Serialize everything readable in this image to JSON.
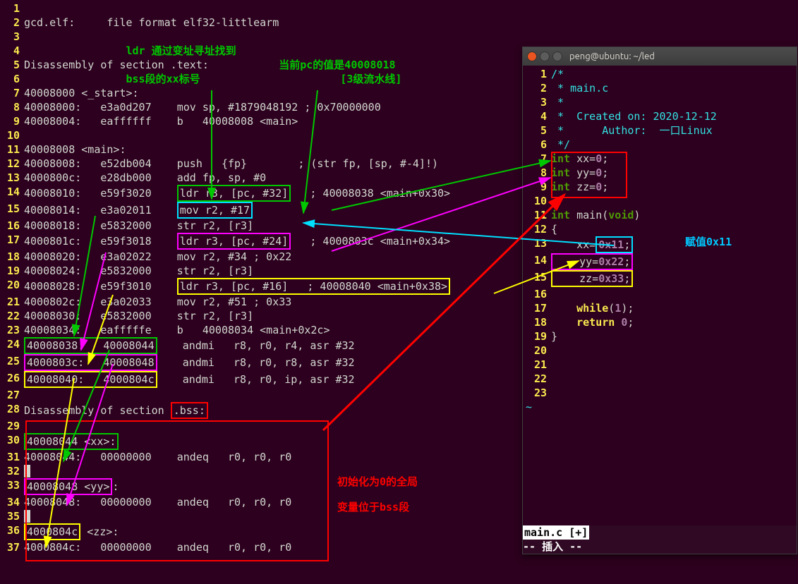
{
  "annotations": {
    "green1": "ldr 通过变址寻址找到",
    "green2": "bss段的xx标号",
    "green3": "当前pc的值是40008018",
    "green4": "[3级流水线]",
    "red1a": "初始化为0的全局",
    "red1b": "变量位于bss段",
    "cyan1": "赋值0x11"
  },
  "left_code": [
    "",
    "gcd.elf:     file format elf32-littlearm",
    "",
    "",
    "Disassembly of section .text:",
    "",
    "40008000 <_start>:",
    "40008000:   e3a0d207    mov sp, #1879048192 ; 0x70000000",
    "40008004:   eaffffff    b   40008008 <main>",
    "",
    "40008008 <main>:",
    "40008008:   e52db004    push   {fp}        ; (str fp, [sp, #-4]!)",
    "4000800c:   e28db000    add fp, sp, #0",
    "40008010:   e59f3020    ldr r3, [pc, #32]   ; 40008038 <main+0x30>",
    "40008014:   e3a02011    mov r2, #17",
    "40008018:   e5832000    str r2, [r3]",
    "4000801c:   e59f3018    ldr r3, [pc, #24]   ; 4000803c <main+0x34>",
    "40008020:   e3a02022    mov r2, #34 ; 0x22",
    "40008024:   e5832000    str r2, [r3]",
    "40008028:   e59f3010    ldr r3, [pc, #16]   ; 40008040 <main+0x38>",
    "4000802c:   e3a02033    mov r2, #51 ; 0x33",
    "40008030:   e5832000    str r2, [r3]",
    "40008034:   eafffffe    b   40008034 <main+0x2c>",
    "40008038:   40008044    andmi   r8, r0, r4, asr #32",
    "4000803c:   40008048    andmi   r8, r0, r8, asr #32",
    "40008040:   4000804c    andmi   r8, r0, ip, asr #32",
    "",
    "Disassembly of section .bss:",
    "",
    "40008044 <xx>:",
    "40008044:   00000000    andeq   r0, r0, r0",
    "",
    "40008048 <yy>:",
    "40008048:   00000000    andeq   r0, r0, r0",
    "",
    "4000804c <zz>:",
    "4000804c:   00000000    andeq   r0, r0, r0"
  ],
  "right": {
    "title": "peng@ubuntu: ~/led",
    "statusfile": "main.c [+]",
    "mode": "-- 插入 --",
    "lines": {
      "c1": "/*",
      "c2": " * main.c",
      "c3": " *",
      "c4": " *  Created on: 2020-12-12",
      "c5": " *      Author:  一口Linux",
      "c6": " */",
      "l7a": "int",
      "l7b": " xx=",
      "l7c": "0",
      "l7d": ";",
      "l8a": "int",
      "l8b": " yy=",
      "l8c": "0",
      "l8d": ";",
      "l9a": "int",
      "l9b": " zz=",
      "l9c": "0",
      "l9d": ";",
      "l11a": "int",
      "l11b": " main(",
      "l11c": "void",
      "l11d": ")",
      "l12": "{",
      "l13a": "    xx=",
      "l13b": "0x11",
      "l13c": ";",
      "l14a": "    yy=",
      "l14b": "0x22",
      "l14c": ";",
      "l15a": "    zz=",
      "l15b": "0x33",
      "l15c": ";",
      "l17a": "    ",
      "l17b": "while",
      "l17c": "(",
      "l17d": "1",
      "l17e": ");",
      "l18a": "    ",
      "l18b": "return",
      "l18c": " ",
      "l18d": "0",
      "l18e": ";",
      "l19": "}"
    }
  }
}
